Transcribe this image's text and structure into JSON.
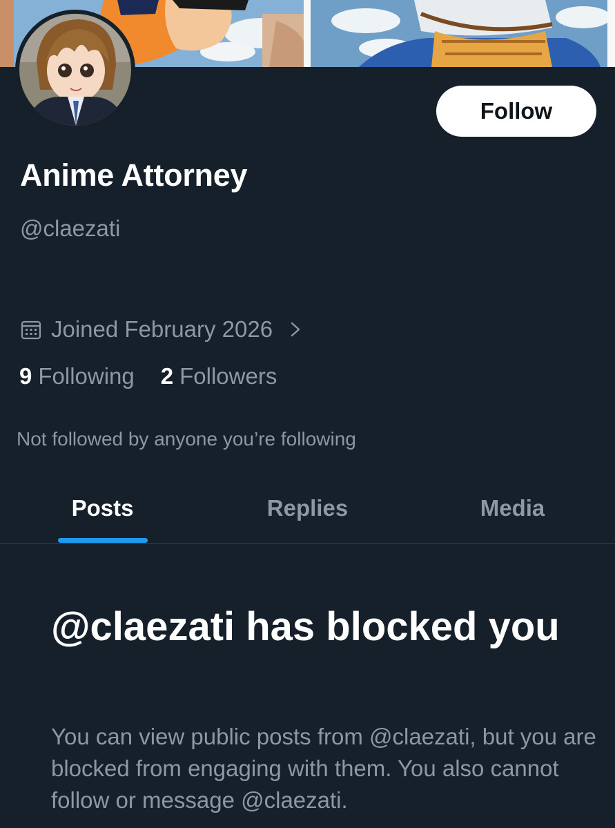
{
  "profile": {
    "display_name": "Anime Attorney",
    "handle": "@claezati",
    "joined": "Joined February 2026",
    "following_count": "9",
    "following_label": "Following",
    "followers_count": "2",
    "followers_label": "Followers",
    "mutuals_note": "Not followed by anyone you’re following"
  },
  "actions": {
    "follow_label": "Follow"
  },
  "tabs": [
    {
      "label": "Posts",
      "active": true
    },
    {
      "label": "Replies",
      "active": false
    },
    {
      "label": "Media",
      "active": false
    }
  ],
  "blocked": {
    "title": "@claezati has blocked you",
    "body": "You can view public posts from @claezati, but you are blocked from engaging with them. You also cannot follow or message @claezati."
  },
  "icons": {
    "calendar": "calendar-icon",
    "chevron": "chevron-right-icon"
  },
  "colors": {
    "background": "#15202b",
    "primary_text": "#ffffff",
    "secondary_text": "#8b98a5",
    "accent": "#1d9bf0",
    "divider": "#38444d"
  }
}
